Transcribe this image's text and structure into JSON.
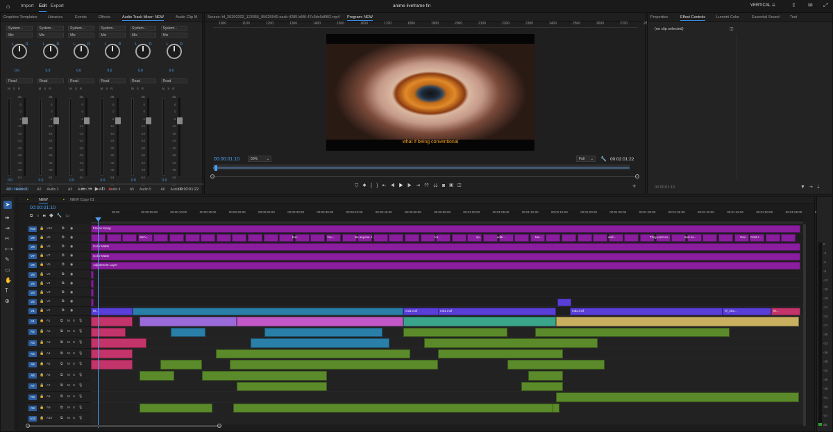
{
  "topbar": {
    "nav": [
      "Import",
      "Edit",
      "Export"
    ],
    "title": "anime liveframe fin",
    "workspace": "VERTICAL"
  },
  "mixer": {
    "tabs": [
      "Graphics Templates",
      "Libraries",
      "Events",
      "Effects",
      "Audio Track Mixer: NEW",
      "Audio Clip M"
    ],
    "channels": [
      {
        "id": "A1",
        "name": "Audio 1",
        "send": "System...",
        "mode": "Mix",
        "auto": "Read",
        "value": "0.0"
      },
      {
        "id": "A2",
        "name": "Audio 2",
        "send": "System...",
        "mode": "Mix",
        "auto": "Read",
        "value": "0.0"
      },
      {
        "id": "A3",
        "name": "Audio 3",
        "send": "System...",
        "mode": "Mix",
        "auto": "Read",
        "value": "0.0"
      },
      {
        "id": "A4",
        "name": "Audio 4",
        "send": "System...",
        "mode": "Mix",
        "auto": "Read",
        "value": "0.0"
      },
      {
        "id": "A5",
        "name": "Audio 5",
        "send": "System...",
        "mode": "Mix",
        "auto": "Read",
        "value": "0.0"
      },
      {
        "id": "A6",
        "name": "Audio 6",
        "send": "System...",
        "mode": "Mix",
        "auto": "Read",
        "value": "0.0"
      }
    ],
    "db_ticks": [
      "dB",
      "6",
      "0",
      "-6",
      "-12",
      "-18",
      "-24",
      "-30",
      "-36",
      "-42",
      "-48",
      "-54",
      "dB"
    ],
    "timecode_left": "00:00:01:10",
    "timecode_right": "00:02:01:22"
  },
  "program": {
    "source_tab": "Source: hf_20260202_123355_55625540-eacb-4285-b5f6-47c3dc6d6f02.mp4",
    "program_tab": "Program: NEW",
    "ruler": [
      "1000",
      "1100",
      "1200",
      "1300",
      "1400",
      "1500",
      "1600",
      "1700",
      "1800",
      "1900",
      "2000",
      "2100",
      "2200",
      "2300",
      "2400",
      "2500",
      "2600",
      "2700",
      "2800"
    ],
    "subtitle": "what if being conventional",
    "timecode": "00:00:01:10",
    "zoom": "50%",
    "quality": "Full",
    "duration": "00:02:01:22"
  },
  "effects": {
    "tabs": [
      "Properties",
      "Effect Controls",
      "Lumetri Color",
      "Essential Sound",
      "Text"
    ],
    "empty": "(no clip selected)",
    "timecode": "00:00:01:10"
  },
  "timeline": {
    "tabs": [
      "NEW",
      "NEW Copy 01"
    ],
    "timecode": "00:00:01:10",
    "ruler": [
      "00:00",
      "00:00:05:00",
      "00:00:10:00",
      "00:00:15:00",
      "00:00:20:00",
      "00:00:25:00",
      "00:00:30:00",
      "00:00:35:00",
      "00:00:40:00",
      "00:00:45:00",
      "00:00:50:00",
      "00:00:55:00",
      "00:01:00:00",
      "00:01:05:00",
      "00:01:10:00",
      "00:01:15:00",
      "00:01:20:00",
      "00:01:25:00",
      "00:01:30:00",
      "00:01:35:00",
      "00:01:40:00",
      "00:01:45:00",
      "00:01:50:00",
      "00:01:55:00",
      "00:02:00:00"
    ],
    "video_tracks": [
      "V10",
      "V9",
      "V8",
      "V7",
      "V6",
      "V5",
      "V4",
      "V3",
      "V2",
      "V1"
    ],
    "audio_tracks": [
      "A1",
      "A2",
      "A3",
      "A4",
      "A5",
      "A6",
      "A7",
      "A8",
      "A9",
      "A10"
    ],
    "clip_labels": {
      "v10": "Frame 8.png",
      "v8": "Color Matte",
      "v7": "Color Matte",
      "v6": "Adjustment Layer",
      "v9": [
        "We'v...",
        "but...",
        "You...",
        "Be anyone, f...",
        "for...",
        "sp...",
        "editi...",
        "Ma...",
        "and...",
        "They post on...",
        "and su...",
        "Onc...",
        "Grab t..."
      ],
      "v1": [
        "M...",
        "md1.mxf",
        "md1.mxf",
        "md2.mxf",
        "hf_202...",
        "M..."
      ]
    },
    "meter_ticks": [
      "0",
      "-3",
      "-6",
      "-9",
      "-12",
      "-15",
      "-18",
      "-21",
      "-24",
      "-27",
      "-30",
      "-33",
      "-36",
      "-39",
      "-42",
      "-45",
      "-48",
      "-51",
      "-54",
      "-57",
      "dB"
    ]
  },
  "colors": {
    "accent": "#3a8be0",
    "purple": "#8a1e9e",
    "violet": "#5a3ed8",
    "teal": "#2a7fa8",
    "green": "#5b8a2a",
    "pink": "#c2346a",
    "timecode": "#4a9ff0"
  }
}
